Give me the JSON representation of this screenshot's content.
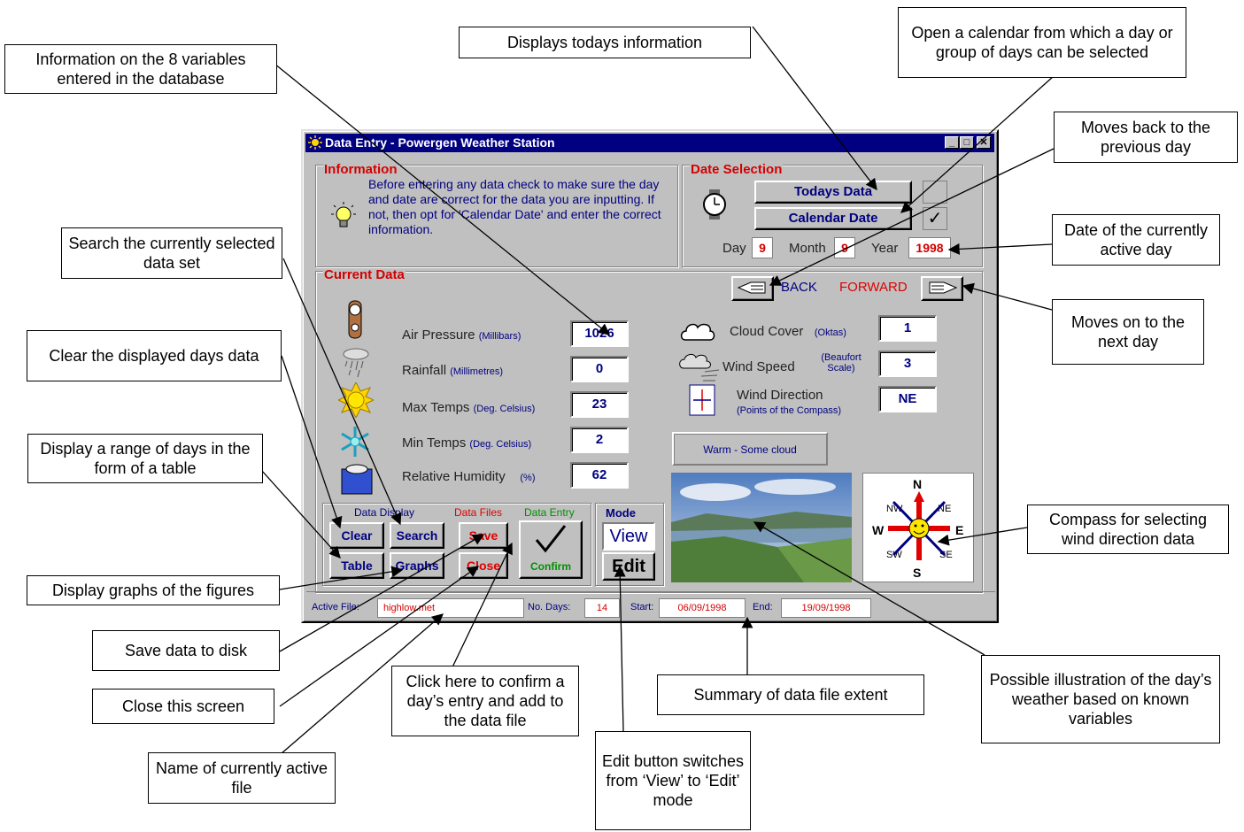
{
  "window": {
    "title": "Data Entry - Powergen Weather Station",
    "min": "_",
    "max": "□",
    "close": "✕"
  },
  "information": {
    "heading": "Information",
    "text": "Before entering any data check to make sure the day and date are correct for the data you are inputting.  If not, then opt for 'Calendar Date' and enter the correct information."
  },
  "date_selection": {
    "heading": "Date Selection",
    "todays_label": "Todays Data",
    "calendar_label": "Calendar Date",
    "calendar_checked": "✓",
    "day_label": "Day",
    "day": "9",
    "month_label": "Month",
    "month": "9",
    "year_label": "Year",
    "year": "1998"
  },
  "current_data": {
    "heading": "Current Data",
    "back_label": "BACK",
    "forward_label": "FORWARD",
    "air_pressure": {
      "label": "Air Pressure",
      "unit": "(Millibars)",
      "value": "1026"
    },
    "rainfall": {
      "label": "Rainfall",
      "unit": "(Millimetres)",
      "value": "0"
    },
    "max_temps": {
      "label": "Max Temps",
      "unit": "(Deg. Celsius)",
      "value": "23"
    },
    "min_temps": {
      "label": "Min Temps",
      "unit": "(Deg. Celsius)",
      "value": "2"
    },
    "humidity": {
      "label": "Relative Humidity",
      "unit": "(%)",
      "value": "62"
    },
    "cloud_cover": {
      "label": "Cloud Cover",
      "unit": "(Oktas)",
      "value": "1"
    },
    "wind_speed": {
      "label": "Wind Speed",
      "unit_line1": "(Beaufort",
      "unit_line2": "Scale)",
      "value": "3"
    },
    "wind_direction": {
      "label": "Wind Direction",
      "unit": "(Points of the Compass)",
      "value": "NE"
    },
    "summary": "Warm - Some cloud"
  },
  "buttons": {
    "data_display_label": "Data Display",
    "data_files_label": "Data Files",
    "data_entry_label": "Data Entry",
    "mode_label": "Mode",
    "clear": "Clear",
    "search": "Search",
    "save": "Save",
    "table": "Table",
    "graphs": "Graphs",
    "close": "Close",
    "confirm": "Confirm",
    "view": "View",
    "edit": "Edit"
  },
  "compass": {
    "n": "N",
    "s": "S",
    "e": "E",
    "w": "W",
    "ne": "NE",
    "nw": "NW",
    "se": "SE",
    "sw": "SW"
  },
  "status_bar": {
    "active_file_label": "Active File:",
    "active_file": "highlow.met",
    "no_days_label": "No. Days:",
    "no_days": "14",
    "start_label": "Start:",
    "start": "06/09/1998",
    "end_label": "End:",
    "end": "19/09/1998"
  },
  "callouts": {
    "variables": "Information on the 8 variables entered in the database",
    "todays": "Displays todays information",
    "calendar": "Open a calendar from which a day or group of days can be selected",
    "back": "Moves back to the previous day",
    "date": "Date of the currently active day",
    "forward": "Moves on to the next day",
    "search": "Search the currently selected data set",
    "clear": "Clear the displayed days data",
    "table": "Display a range of days in the form of a table",
    "graphs": "Display graphs of the figures",
    "save": "Save data to disk",
    "close": "Close this screen",
    "file": "Name of currently active file",
    "confirm": "Click here to confirm a day’s entry and add to the data file",
    "edit": "Edit button switches from ‘View’ to ‘Edit’ mode",
    "summary": "Summary of data file extent",
    "illustration": "Possible illustration of the day’s weather based on known variables",
    "compass": "Compass for selecting wind direction data"
  }
}
